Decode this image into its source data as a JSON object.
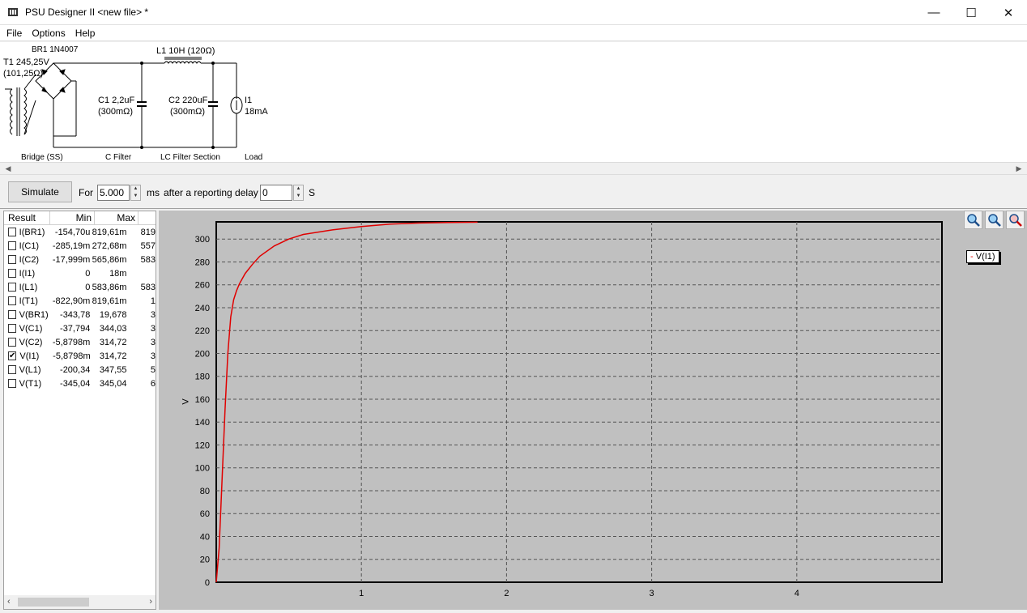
{
  "window": {
    "title": "PSU Designer II  <new file> *",
    "minimize": "—",
    "maximize": "☐",
    "close": "✕"
  },
  "menu": [
    "File",
    "Options",
    "Help"
  ],
  "schematic": {
    "bridge_label": "BR1 1N4007",
    "transformer_label": "T1 245,25V",
    "transformer_res": "(101,25Ω)",
    "inductor_label": "L1 10H (120Ω)",
    "c1_label": "C1 2,2uF",
    "c1_res": "(300mΩ)",
    "c2_label": "C2 220uF",
    "c2_res": "(300mΩ)",
    "load_name": "I1",
    "load_value": "18mA",
    "section_bridge": "Bridge (SS)",
    "section_cfilter": "C Filter",
    "section_lc": "LC Filter Section",
    "section_load": "Load"
  },
  "simbar": {
    "simulate_label": "Simulate",
    "for_label": "For",
    "duration_value": "5.000",
    "duration_unit": "ms",
    "delay_label": "after a reporting delay of",
    "delay_value": "0",
    "delay_unit": "S"
  },
  "results": {
    "headers": [
      "Result",
      "Min",
      "Max"
    ],
    "rows": [
      {
        "checked": false,
        "name": "I(BR1)",
        "min": "-154,70u",
        "max": "819,61m",
        "avg": "819"
      },
      {
        "checked": false,
        "name": "I(C1)",
        "min": "-285,19m",
        "max": "272,68m",
        "avg": "557"
      },
      {
        "checked": false,
        "name": "I(C2)",
        "min": "-17,999m",
        "max": "565,86m",
        "avg": "583"
      },
      {
        "checked": false,
        "name": "I(I1)",
        "min": "0",
        "max": "18m",
        "avg": ""
      },
      {
        "checked": false,
        "name": "I(L1)",
        "min": "0",
        "max": "583,86m",
        "avg": "583"
      },
      {
        "checked": false,
        "name": "I(T1)",
        "min": "-822,90m",
        "max": "819,61m",
        "avg": "1"
      },
      {
        "checked": false,
        "name": "V(BR1)",
        "min": "-343,78",
        "max": "19,678",
        "avg": "3"
      },
      {
        "checked": false,
        "name": "V(C1)",
        "min": "-37,794",
        "max": "344,03",
        "avg": "3"
      },
      {
        "checked": false,
        "name": "V(C2)",
        "min": "-5,8798m",
        "max": "314,72",
        "avg": "3"
      },
      {
        "checked": true,
        "name": "V(I1)",
        "min": "-5,8798m",
        "max": "314,72",
        "avg": "3"
      },
      {
        "checked": false,
        "name": "V(L1)",
        "min": "-200,34",
        "max": "347,55",
        "avg": "5"
      },
      {
        "checked": false,
        "name": "V(T1)",
        "min": "-345,04",
        "max": "345,04",
        "avg": "6"
      }
    ]
  },
  "chart_data": {
    "type": "line",
    "ylabel": "V",
    "xlabel": "",
    "xlim": [
      0,
      5
    ],
    "ylim": [
      0,
      315
    ],
    "yticks": [
      0,
      20,
      40,
      60,
      80,
      100,
      120,
      140,
      160,
      180,
      200,
      220,
      240,
      260,
      280,
      300
    ],
    "xticks": [
      1,
      2,
      3,
      4
    ],
    "grid": true,
    "legend_position": "top-right",
    "series": [
      {
        "name": "V(I1)",
        "color": "#e00000",
        "x": [
          0,
          0.02,
          0.04,
          0.06,
          0.08,
          0.1,
          0.12,
          0.14,
          0.16,
          0.2,
          0.25,
          0.3,
          0.4,
          0.5,
          0.6,
          0.8,
          1.0,
          1.2,
          1.4,
          1.6,
          1.8
        ],
        "y": [
          0,
          30,
          90,
          150,
          200,
          232,
          247,
          255,
          261,
          270,
          278,
          285,
          294,
          300,
          304,
          308,
          311,
          313,
          314,
          314.5,
          314.7
        ]
      }
    ]
  },
  "icons": {
    "zoom_in": "zoom-in-icon",
    "zoom_out": "zoom-out-icon",
    "zoom_reset": "zoom-reset-icon"
  }
}
